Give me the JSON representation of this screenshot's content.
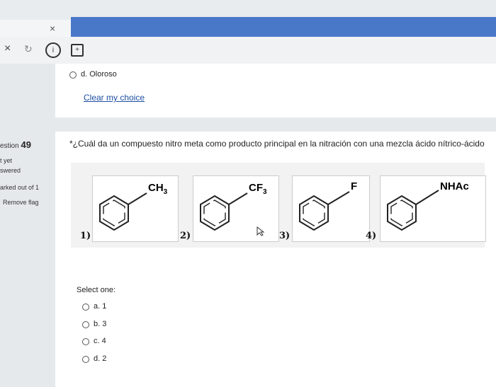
{
  "browser": {
    "tab_close": "×",
    "toolbar_close": "×"
  },
  "sidebar": {
    "question_label": "estion",
    "question_number": "49",
    "status_line1": "t yet",
    "status_line2": "swered",
    "marked": "arked out of 1",
    "remove_flag": "Remove flag"
  },
  "prev_question": {
    "option_d": "d. Oloroso",
    "clear_choice": "Clear my choice"
  },
  "question": {
    "text": "*¿Cuál da un compuesto nitro meta como producto principal en la nitración con una mezcla ácido nítrico-ácido",
    "structures": [
      {
        "number": "1)",
        "substituent": "CH3"
      },
      {
        "number": "2)",
        "substituent": "CF3"
      },
      {
        "number": "3)",
        "substituent": "F"
      },
      {
        "number": "4)",
        "substituent": "NHAc"
      }
    ],
    "select_one": "Select one:",
    "options": [
      "a. 1",
      "b. 3",
      "c. 4",
      "d. 2"
    ]
  }
}
